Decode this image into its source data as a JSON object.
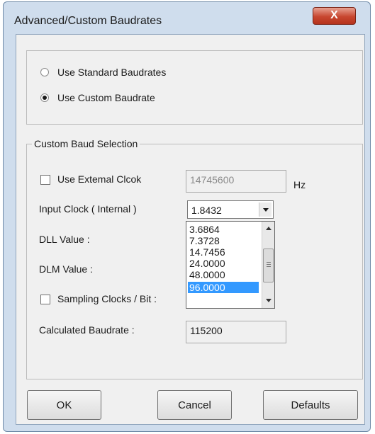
{
  "window": {
    "title": "Advanced/Custom Baudrates",
    "close_glyph": "X"
  },
  "baudrate_mode": {
    "options": [
      {
        "label": "Use Standard Baudrates",
        "selected": false
      },
      {
        "label": "Use Custom Baudrate",
        "selected": true
      }
    ]
  },
  "custom_baud": {
    "group_label": "Custom Baud Selection",
    "external_clock": {
      "label": "Use Extemal Clcok",
      "checked": false,
      "value": "14745600",
      "unit": "Hz"
    },
    "input_clock": {
      "label": "Input Clock ( Internal )",
      "selected_value": "1.8432",
      "dropdown_open": true,
      "options": [
        "3.6864",
        "7.3728",
        "14.7456",
        "24.0000",
        "48.0000",
        "96.0000"
      ],
      "highlighted_option": "96.0000"
    },
    "dll_label": "DLL Value :",
    "dlm_label": "DLM Value :",
    "sampling": {
      "label": "Sampling Clocks / Bit :",
      "checked": false
    },
    "calculated": {
      "label": "Calculated Baudrate :",
      "value": "115200"
    }
  },
  "buttons": {
    "ok": "OK",
    "cancel": "Cancel",
    "defaults": "Defaults"
  },
  "colors": {
    "selection_highlight": "#3399ff",
    "close_button": "#c7462f",
    "window_frame": "#cfdded"
  }
}
